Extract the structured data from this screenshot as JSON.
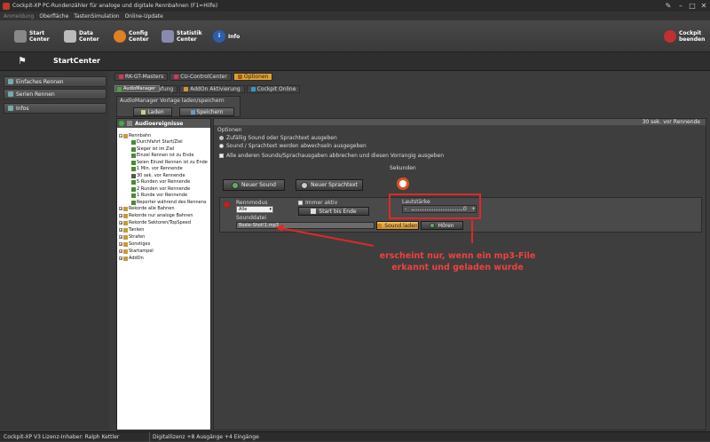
{
  "window": {
    "title": "Cockpit-XP PC-Rundenzähler für analoge und digitale Rennbahnen (F1=Hilfe)"
  },
  "menu": {
    "items": [
      "Anmeldung",
      "Oberfläche",
      "TastenSimulation",
      "Online-Update"
    ]
  },
  "toolbar": {
    "start": "Start Center",
    "data": "Data Center",
    "config": "Config Center",
    "statistik": "Statistik Center",
    "info": "Info",
    "exit": "Cockpit beenden"
  },
  "page_title": "StartCenter",
  "sidebar": {
    "items": [
      {
        "label": "Einfaches Rennen"
      },
      {
        "label": "Serien Rennen"
      },
      {
        "label": "Infos"
      }
    ]
  },
  "top_tabs": {
    "rk": "RK-GT-Masters",
    "cu": "CU-ControlCenter",
    "optionen": "Optionen"
  },
  "sub_tabs": {
    "tasten": "Tasten-Bestrafung",
    "audio": "AudioManager",
    "addon": "AddOn Aktivierung",
    "cockpit": "Cockpit Online"
  },
  "vorlage": {
    "label": "AudioManager Vorlage laden/speichern",
    "laden": "Laden",
    "speichern": "Speichern"
  },
  "tree": {
    "header": "Audioereignisse",
    "nodes": {
      "rennbahn": "Rennbahn",
      "durchfahrt": "Durchfahrt Start/Ziel",
      "sieger": "Sieger ist im Ziel",
      "einzel_ende": "Einzel Rennen ist zu Ende",
      "seien_einzel": "Seien Einzel Rennen ist zu Ende",
      "min1": "1 Min. vor Rennende",
      "sek30": "30 sek. vor Rennende",
      "r5": "5 Runden vor Rennende",
      "r2": "2 Runden vor Rennende",
      "r1": "1 Runde vor Rennende",
      "reporter": "Reporter während des Rennens",
      "rekorde_alle": "Rekorde alle Bahnen",
      "rekorde_analog": "Rekorde nur analoge Bahnen",
      "rekorde_sek": "Rekorde Sektoren/TopSpeed",
      "tanken": "Tanken",
      "strafen": "Strafen",
      "sonstiges": "Sonstiges",
      "startampel": "Startampel",
      "addon": "AddOn"
    }
  },
  "main": {
    "header": "30 sek. vor Rennende",
    "optionen_label": "Optionen",
    "radio1": "Zufällig Sound oder Sprachtext ausgeben",
    "radio2": "Sound / Sprachtext werden abwechseln ausgegeben",
    "check1": "Alle anderen Sounds/Sprachausgaben abbrechen und diesen Vorrangig ausgeben",
    "sekunden": "Sekunden",
    "neuer_sound": "Neuer Sound",
    "neuer_sprachtext": "Neuer Sprachtext",
    "rennmodus_label": "Rennmodus",
    "rennmodus_value": "Alle",
    "immer_aktiv": "Immer aktiv",
    "start_bis_ende": "Start bis Ende",
    "lautstaerke_label": "Lautstärke",
    "lautstaerke_minus": "-",
    "lautstaerke_plus": "+",
    "lautstaerke_value": "0",
    "sounddatei_label": "Sounddatei",
    "sounddatei_value": "Boxle-Shot!1.mp3",
    "sound_laden": "Sound laden",
    "hoeren": "Hören"
  },
  "annotation": {
    "line1": "erscheint nur, wenn ein mp3-File",
    "line2": "erkannt und geladen wurde"
  },
  "status": {
    "license": "Cockpit-XP V3 Lizenz-Inhaber: Ralph Kettler",
    "digital": "Digitallizenz  +8 Ausgänge +4 Eingänge"
  },
  "colors": {
    "annotation": "#e02828",
    "active_tab": "#e0a030"
  }
}
